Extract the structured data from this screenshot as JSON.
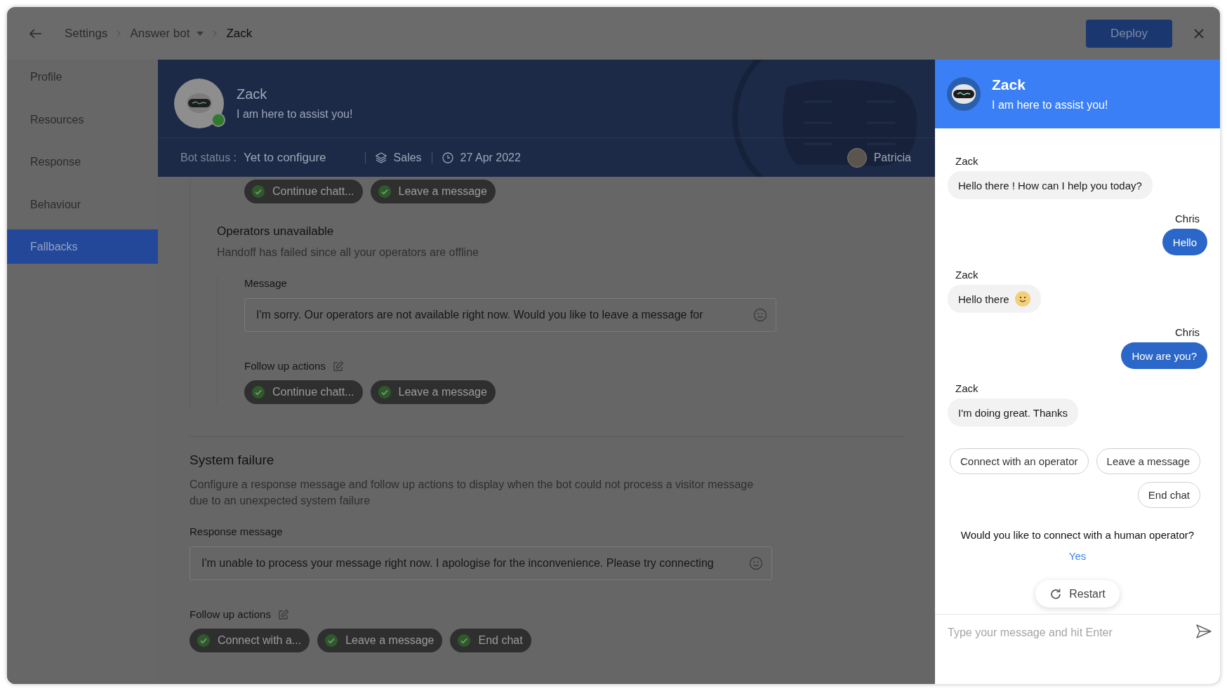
{
  "top_bar": {
    "breadcrumbs": [
      {
        "label": "Settings",
        "current": false,
        "dropdown": false
      },
      {
        "label": "Answer bot",
        "current": false,
        "dropdown": true
      },
      {
        "label": "Zack",
        "current": true,
        "dropdown": false
      }
    ],
    "deploy_button": "Deploy"
  },
  "sidebar": {
    "items": [
      {
        "label": "Profile",
        "selected": false
      },
      {
        "label": "Resources",
        "selected": false
      },
      {
        "label": "Response",
        "selected": false
      },
      {
        "label": "Behaviour",
        "selected": false
      },
      {
        "label": "Fallbacks",
        "selected": true
      }
    ]
  },
  "bot_banner": {
    "name": "Zack",
    "tagline": "I am here to assist you!",
    "online": true,
    "status_label": "Bot status :",
    "status_value": "Yet to configure",
    "department": "Sales",
    "date": "27 Apr 2022",
    "owner": "Patricia"
  },
  "fallbacks": {
    "top_actions": [
      {
        "label": "Continue chatt...",
        "checked": true
      },
      {
        "label": "Leave a message",
        "checked": true
      }
    ],
    "operators_unavailable": {
      "title": "Operators unavailable",
      "description": "Handoff has failed since all your operators are offline",
      "message_label": "Message",
      "message_value": "I'm sorry. Our operators are not available right now. Would you like to leave a message for",
      "followup_label": "Follow up actions",
      "actions": [
        {
          "label": "Continue chatt...",
          "checked": true
        },
        {
          "label": "Leave a message",
          "checked": true
        }
      ]
    },
    "system_failure": {
      "title": "System failure",
      "description": "Configure a response message and follow up actions to display when the bot could not process a visitor message due to an unexpected system failure",
      "message_label": "Response message",
      "message_value": "I'm unable to process your message right now. I apologise for the inconvenience. Please try connecting",
      "followup_label": "Follow up actions",
      "actions": [
        {
          "label": "Connect with a...",
          "checked": true
        },
        {
          "label": "Leave a message",
          "checked": true
        },
        {
          "label": "End chat",
          "checked": true
        }
      ]
    }
  },
  "chat_preview": {
    "name": "Zack",
    "tagline": "I am here to assist you!",
    "messages": [
      {
        "kind": "bot",
        "sender": "Zack",
        "text": "Hello there ! How can I help you today?",
        "emoji": false
      },
      {
        "kind": "visitor",
        "sender": "Chris",
        "text": "Hello",
        "emoji": false
      },
      {
        "kind": "bot",
        "sender": "Zack",
        "text": "Hello there",
        "emoji": true
      },
      {
        "kind": "visitor",
        "sender": "Chris",
        "text": "How are you?",
        "emoji": false
      },
      {
        "kind": "bot",
        "sender": "Zack",
        "text": "I'm doing great. Thanks",
        "emoji": false
      }
    ],
    "quick_replies": [
      "Connect with an operator",
      "Leave a message",
      "End chat"
    ],
    "question": "Would you like to connect with a human operator?",
    "answer_link": "Yes",
    "restart_button": "Restart",
    "input": {
      "placeholder": "Type your message and hit Enter"
    }
  }
}
